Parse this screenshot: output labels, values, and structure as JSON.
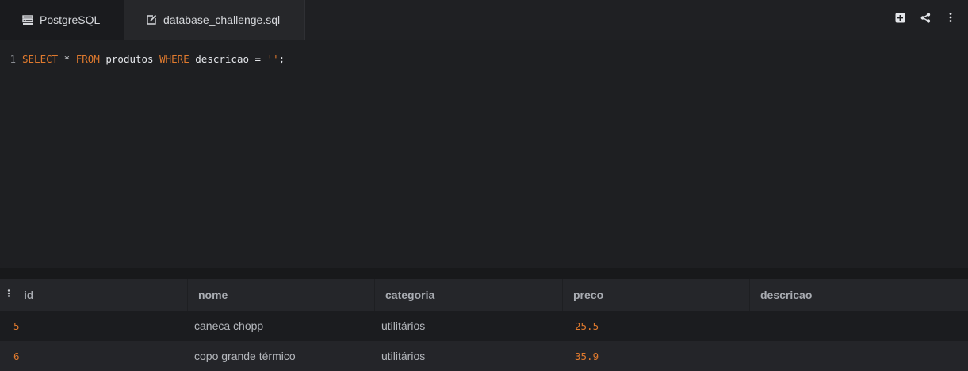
{
  "tabs": {
    "database": {
      "label": "PostgreSQL",
      "icon": "database-list-icon"
    },
    "file": {
      "label": "database_challenge.sql",
      "icon": "edit-icon"
    }
  },
  "toolbar": {
    "icons": [
      "add-tab-icon",
      "share-icon",
      "more-vertical-icon"
    ]
  },
  "editor": {
    "line_number": "1",
    "tokens": {
      "select": "SELECT",
      "star": " * ",
      "from": "FROM",
      "table": " produtos ",
      "where": "WHERE",
      "rest": " descricao = ",
      "string": "''",
      "semicolon": ";"
    }
  },
  "results": {
    "columns": [
      "id",
      "nome",
      "categoria",
      "preco",
      "descricao"
    ],
    "rows": [
      {
        "id": "5",
        "nome": "caneca chopp",
        "categoria": "utilitários",
        "preco": "25.5",
        "descricao": ""
      },
      {
        "id": "6",
        "nome": "copo grande térmico",
        "categoria": "utilitários",
        "preco": "35.9",
        "descricao": ""
      }
    ]
  },
  "colors": {
    "keyword": "#e07a2e",
    "number": "#e07a2e",
    "background": "#1e1f22"
  }
}
